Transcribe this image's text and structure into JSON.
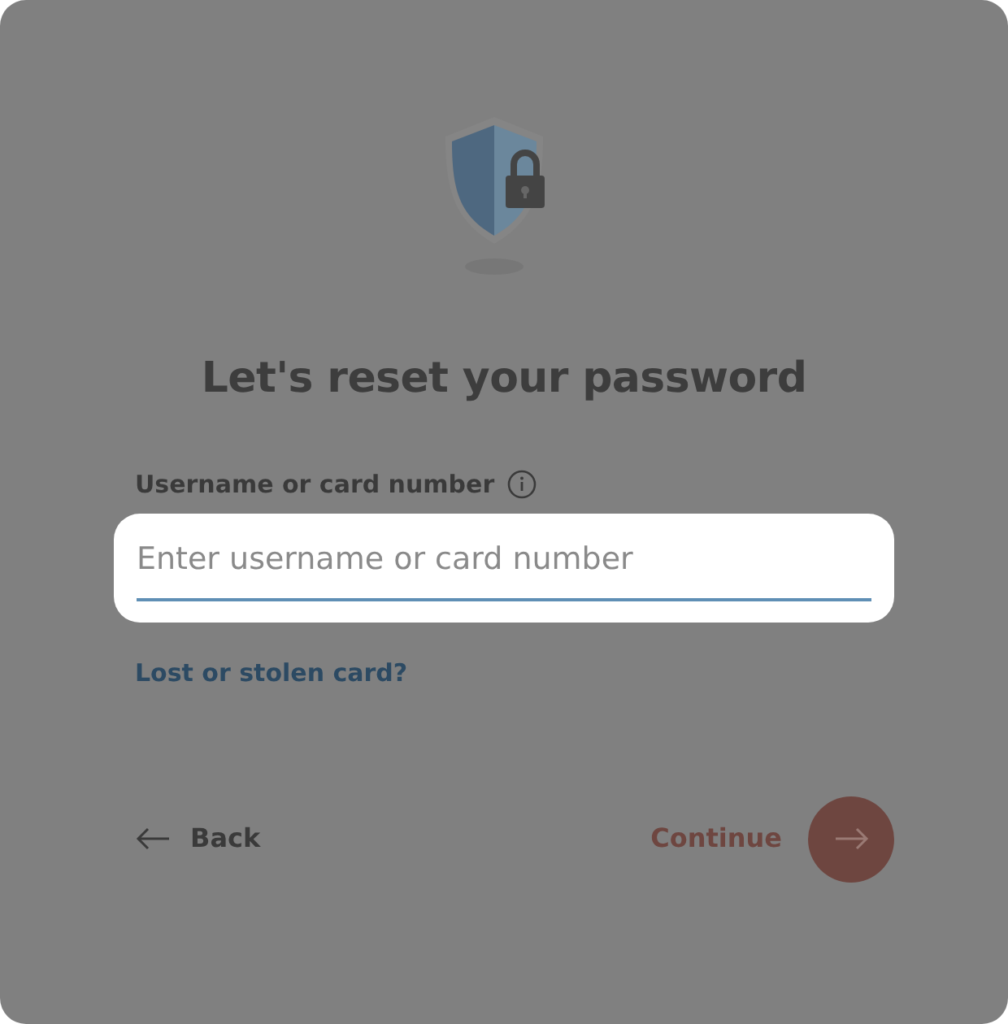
{
  "title": "Let's reset your password",
  "field": {
    "label": "Username or card number",
    "placeholder": "Enter username or card number"
  },
  "link": "Lost or stolen card?",
  "back": {
    "label": "Back"
  },
  "continue": {
    "label": "Continue"
  }
}
